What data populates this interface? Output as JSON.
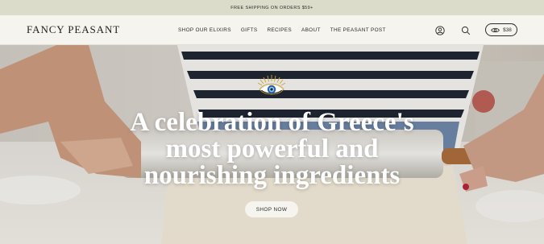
{
  "promo": {
    "text": "FREE SHIPPING ON ORDERS $59+"
  },
  "header": {
    "logo": "FANCY PEASANT",
    "nav": [
      {
        "label": "SHOP OUR ELIXIRS"
      },
      {
        "label": "GIFTS"
      },
      {
        "label": "RECIPES"
      },
      {
        "label": "ABOUT"
      },
      {
        "label": "THE PEASANT POST"
      }
    ],
    "icons": {
      "account": "account-icon",
      "search": "search-icon",
      "cart": "eye-icon"
    },
    "cart_amount": "$38"
  },
  "hero": {
    "headline_lines": [
      "A celebration of Greece's",
      "most powerful and",
      "nourishing ingredients"
    ],
    "cta_label": "SHOP NOW",
    "emblem": "evil-eye-icon"
  },
  "colors": {
    "promo_bg": "#dcdccb",
    "header_bg": "#f6f4ee",
    "text_dark": "#2b2b28",
    "eye_blue": "#2a5ea8",
    "eye_gold": "#c9a43a"
  }
}
